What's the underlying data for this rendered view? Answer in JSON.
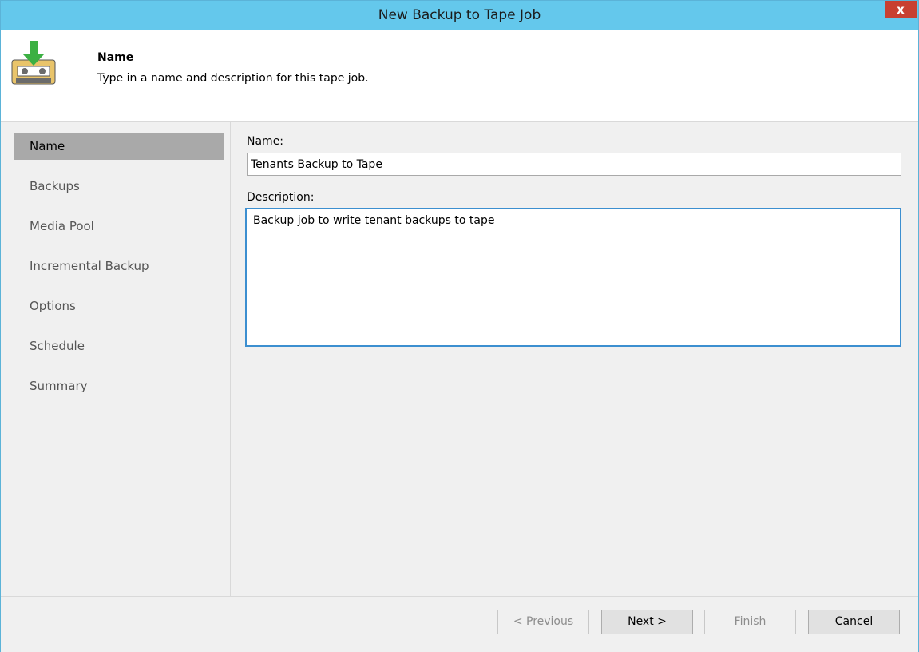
{
  "window": {
    "title": "New Backup to Tape Job",
    "close_label": "x"
  },
  "header": {
    "icon": "tape-cassette-download-icon",
    "title": "Name",
    "description": "Type in a name and description for this tape job."
  },
  "steps": [
    {
      "label": "Name",
      "active": true
    },
    {
      "label": "Backups",
      "active": false
    },
    {
      "label": "Media Pool",
      "active": false
    },
    {
      "label": "Incremental Backup",
      "active": false
    },
    {
      "label": "Options",
      "active": false
    },
    {
      "label": "Schedule",
      "active": false
    },
    {
      "label": "Summary",
      "active": false
    }
  ],
  "form": {
    "name_label": "Name:",
    "name_value": "Tenants Backup to Tape",
    "description_label": "Description:",
    "description_value": "Backup job to write tenant backups to tape"
  },
  "buttons": {
    "previous": "< Previous",
    "next": "Next >",
    "finish": "Finish",
    "cancel": "Cancel"
  },
  "colors": {
    "titlebar": "#64c8ec",
    "close": "#c84031",
    "active_step": "#a9a9a9",
    "focus_border": "#3c8fd0"
  }
}
